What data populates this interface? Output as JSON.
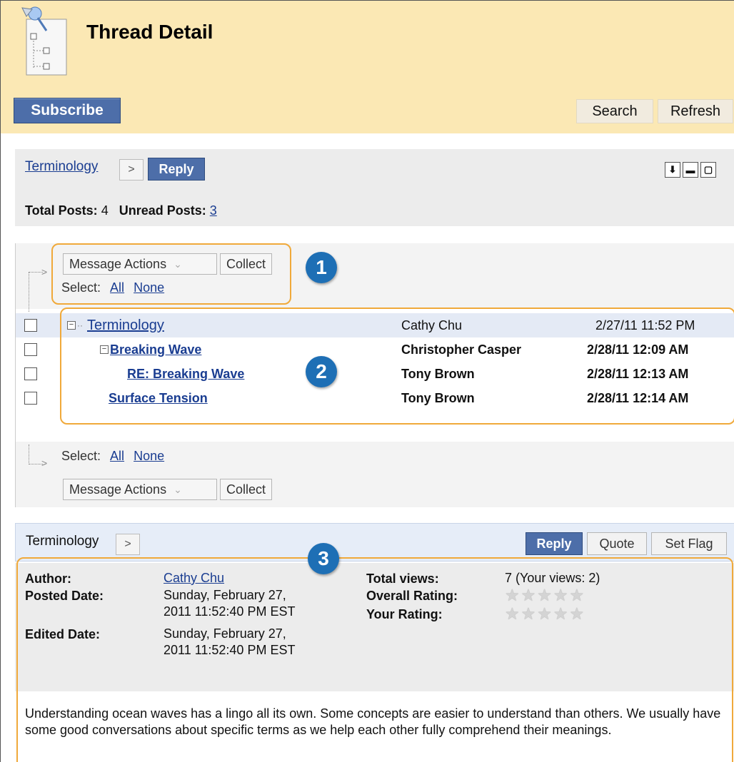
{
  "header": {
    "title": "Thread Detail",
    "subscribe_label": "Subscribe",
    "search_label": "Search",
    "refresh_label": "Refresh"
  },
  "summary": {
    "forum_link": "Terminology",
    "next_glyph": ">",
    "reply_label": "Reply",
    "total_posts_label": "Total Posts:",
    "total_posts": "4",
    "unread_posts_label": "Unread Posts:",
    "unread_posts": "3"
  },
  "message_actions": {
    "actions_label": "Message Actions",
    "collect_label": "Collect",
    "select_label": "Select:",
    "all_label": "All",
    "none_label": "None"
  },
  "callouts": [
    "1",
    "2",
    "3"
  ],
  "messages": [
    {
      "subject": "Terminology",
      "author": "Cathy Chu",
      "date": "2/27/11 11:52 PM"
    },
    {
      "subject": "Breaking Wave",
      "author": "Christopher Casper",
      "date": "2/28/11 12:09 AM"
    },
    {
      "subject": "RE: Breaking Wave",
      "author": "Tony Brown",
      "date": "2/28/11 12:13 AM"
    },
    {
      "subject": "Surface Tension",
      "author": "Tony Brown",
      "date": "2/28/11 12:14 AM"
    }
  ],
  "detail": {
    "crumb": "Terminology",
    "next_glyph": ">",
    "reply_label": "Reply",
    "quote_label": "Quote",
    "set_flag_label": "Set Flag",
    "author_label": "Author:",
    "author": "Cathy Chu",
    "posted_label": "Posted Date:",
    "posted_line1": "Sunday, February 27,",
    "posted_line2": "2011 11:52:40 PM EST",
    "edited_label": "Edited Date:",
    "edited_line1": "Sunday, February 27,",
    "edited_line2": "2011 11:52:40 PM EST",
    "views_label": "Total views:",
    "views": "7 (Your views: 2)",
    "overall_rating_label": "Overall Rating:",
    "your_rating_label": "Your Rating:",
    "body": "Understanding ocean waves has a lingo all its own. Some concepts are easier to understand than others. We usually have some good conversations about specific terms as we help each other fully comprehend their meanings."
  },
  "colors": {
    "header_bg": "#fbe8b4",
    "button_blue": "#4d6ea9",
    "link": "#1a3d91",
    "callout_orange": "#f0a93a",
    "callout_blue": "#1e6fb5"
  },
  "icons": [
    "thread-tree-icon",
    "download-icon",
    "minimize-icon",
    "maximize-icon",
    "expand-collapse-icon",
    "star-icon"
  ]
}
